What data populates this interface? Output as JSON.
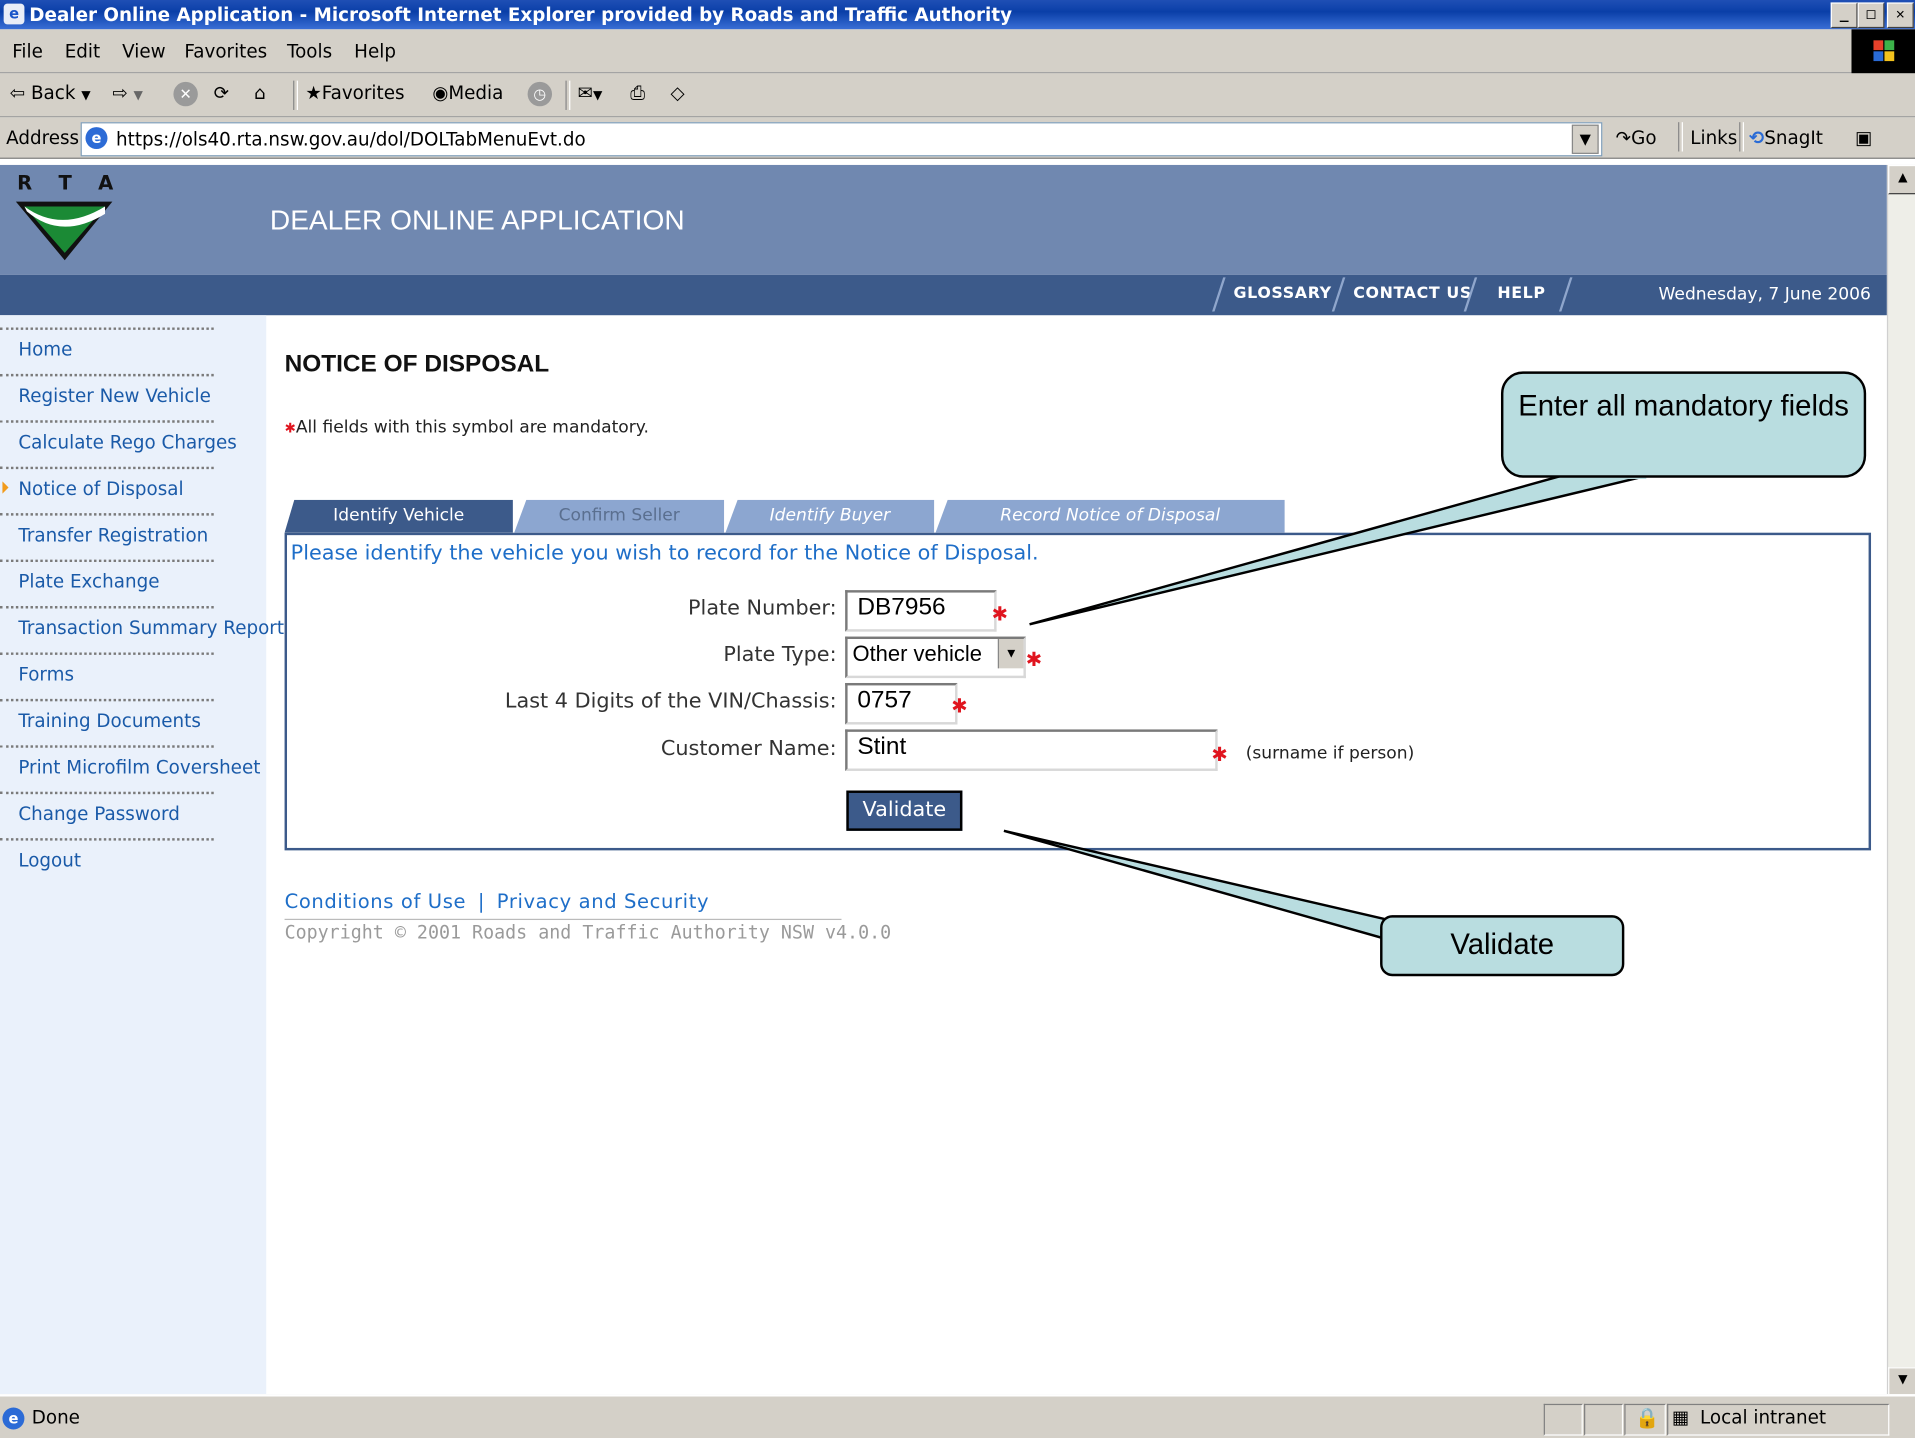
{
  "window": {
    "title": "Dealer Online Application - Microsoft Internet Explorer provided by Roads and Traffic Authority",
    "controls": [
      "_",
      "□",
      "✕"
    ]
  },
  "menu": [
    "File",
    "Edit",
    "View",
    "Favorites",
    "Tools",
    "Help"
  ],
  "toolbar": {
    "back": "Back",
    "favorites": "Favorites",
    "media": "Media"
  },
  "address": {
    "label": "Address",
    "url": "https://ols40.rta.nsw.gov.au/dol/DOLTabMenuEvt.do",
    "go": "Go",
    "links": "Links",
    "snagit": "SnagIt"
  },
  "header": {
    "logo_letters": "R T A",
    "app_title": "DEALER ONLINE APPLICATION",
    "nav": [
      "GLOSSARY",
      "CONTACT US",
      "HELP"
    ],
    "date": "Wednesday, 7 June 2006"
  },
  "sidebar": {
    "items": [
      "Home",
      "Register New Vehicle",
      "Calculate Rego Charges",
      "Notice of Disposal",
      "Transfer Registration",
      "Plate Exchange",
      "Transaction Summary Report",
      "Forms",
      "Training Documents",
      "Print Microfilm Coversheet",
      "Change Password",
      "Logout"
    ],
    "active_index": 3
  },
  "main": {
    "title": "NOTICE OF DISPOSAL",
    "mandatory_note": "All fields with this symbol are mandatory.",
    "tabs": [
      "Identify Vehicle",
      "Confirm Seller",
      "Identify Buyer",
      "Record Notice of Disposal"
    ],
    "active_tab": 0,
    "intro": "Please identify the vehicle you wish to record for the Notice of Disposal.",
    "fields": {
      "plate_number": {
        "label": "Plate Number:",
        "value": "DB7956"
      },
      "plate_type": {
        "label": "Plate Type:",
        "value": "Other vehicle"
      },
      "vin_last4": {
        "label": "Last 4 Digits of the VIN/Chassis:",
        "value": "0757"
      },
      "customer_name": {
        "label": "Customer Name:",
        "value": "Stint",
        "hint": "(surname if person)"
      }
    },
    "required_marker": "✱",
    "validate_button": "Validate"
  },
  "footer": {
    "conditions": "Conditions of Use",
    "divider": "|",
    "privacy": "Privacy and Security",
    "copyright": "Copyright © 2001 Roads and Traffic Authority NSW v4.0.0"
  },
  "callouts": {
    "mandatory": "Enter all mandatory fields",
    "validate": "Validate"
  },
  "status": {
    "text": "Done",
    "zone": "Local intranet"
  },
  "colors": {
    "banner": "#7088b0",
    "nav_band": "#3c5a8a",
    "link": "#1e6ec8",
    "required": "#e0141e",
    "callout_fill": "#b9dde0"
  }
}
